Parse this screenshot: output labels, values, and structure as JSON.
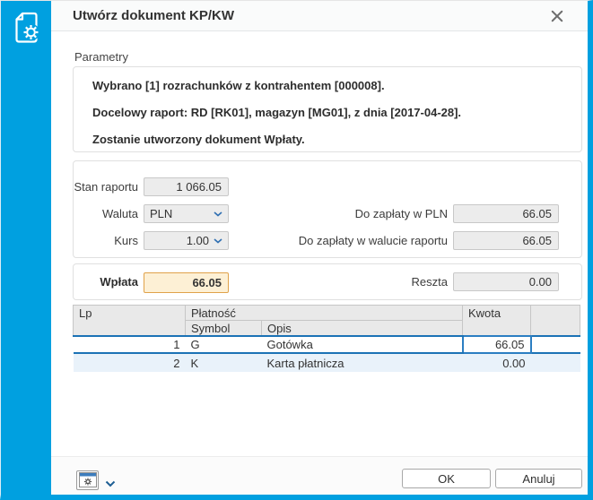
{
  "dialog": {
    "title": "Utwórz dokument KP/KW"
  },
  "icons": {
    "sidebar": "document-gear-icon",
    "close": "close-icon",
    "dropdowns": "chevron-down-icon",
    "settings": "window-gear-icon",
    "settings_expand": "chevron-down-icon"
  },
  "colors": {
    "accent_blue": "#00a0e0",
    "selection_blue": "#1b72b5",
    "focus_cell_border": "#2b7ec2",
    "wplata_bg": "#fdf0d5",
    "wplata_border": "#e0a24a",
    "alt_row_bg": "#e9f2fa"
  },
  "params": {
    "label": "Parametry",
    "lines": [
      "Wybrano [1] rozrachunków z kontrahentem [000008].",
      "Docelowy raport: RD [RK01], magazyn [MG01], z dnia [2017-04-28].",
      "Zostanie utworzony dokument Wpłaty."
    ]
  },
  "fields": {
    "stan_raportu": {
      "label": "Stan raportu",
      "value": "1 066.05"
    },
    "waluta": {
      "label": "Waluta",
      "value": "PLN"
    },
    "kurs": {
      "label": "Kurs",
      "value": "1.00"
    },
    "do_zaplaty_pln": {
      "label": "Do zapłaty w PLN",
      "value": "66.05"
    },
    "do_zaplaty_waluta": {
      "label": "Do zapłaty w walucie raportu",
      "value": "66.05"
    },
    "wplata": {
      "label": "Wpłata",
      "value": "66.05"
    },
    "reszta": {
      "label": "Reszta",
      "value": "0.00"
    }
  },
  "table": {
    "headers": {
      "lp": "Lp",
      "platnosc": "Płatność",
      "symbol": "Symbol",
      "opis": "Opis",
      "kwota": "Kwota"
    },
    "rows": [
      {
        "lp": "1",
        "symbol": "G",
        "opis": "Gotówka",
        "kwota": "66.05"
      },
      {
        "lp": "2",
        "symbol": "K",
        "opis": "Karta płatnicza",
        "kwota": "0.00"
      }
    ]
  },
  "footer": {
    "ok_label": "OK",
    "cancel_label": "Anuluj"
  }
}
